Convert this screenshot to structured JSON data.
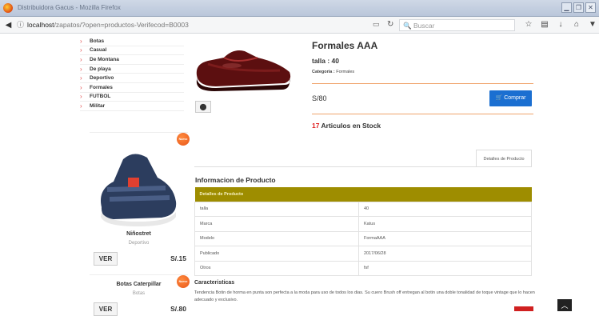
{
  "window": {
    "title": "Distribuidora Gacus - Mozilla Firefox",
    "min": "▁",
    "max": "❐",
    "close": "✕"
  },
  "browser": {
    "url_host": "localhost",
    "url_path": "/zapatos/?open=productos-Verifecod=B0003",
    "search_placeholder": "Buscar"
  },
  "sidebar": {
    "categories": [
      "Botas",
      "Casual",
      "De Montana",
      "De playa",
      "Deportivo",
      "Formales",
      "FUTBOL",
      "Militar"
    ]
  },
  "related_products": [
    {
      "badge": "Nuevo",
      "name": "Niñostret",
      "category": "Deportivo",
      "price": "S/.15",
      "button": "VER"
    },
    {
      "badge": "Nuevo",
      "name": "Botas Caterpillar",
      "category": "Botas",
      "price": "S/.80",
      "button": "VER"
    }
  ],
  "product": {
    "title": "Formales AAA",
    "talla": "talla : 40",
    "category_label": "Categoria :",
    "category_value": "Formales",
    "price": "S/80",
    "buy_label": "Comprar",
    "stock_count": "17",
    "stock_text": "Articulos en Stock"
  },
  "tabs": {
    "details": "Detalles de Producto"
  },
  "info": {
    "title": "Informacion de Producto",
    "table_header": "Detalles de Producto",
    "rows": [
      {
        "key": "talla",
        "value": "40"
      },
      {
        "key": "Marca",
        "value": "Katus"
      },
      {
        "key": "Modelo",
        "value": "FormaAAA"
      },
      {
        "key": "Publicado",
        "value": "2017/06/28"
      },
      {
        "key": "Otros",
        "value": "fsf"
      }
    ]
  },
  "features": {
    "title": "Caracteristicas",
    "text": "Tendencia Botin de horma en punta son perfecta a la moda para uso de todos los dias. Su cuero Brush off entregan al botin una doble tonalidad de toque vintage que lo hacen adecuado y exclusivo."
  },
  "colors": {
    "accent_blue": "#1b6fd1",
    "table_header": "#9e8d00",
    "badge_orange": "#e8561a",
    "stock_red": "#e02020"
  }
}
